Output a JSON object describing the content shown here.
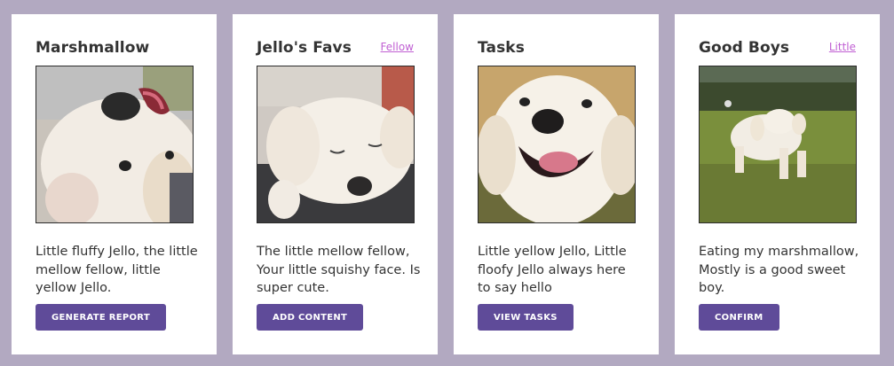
{
  "cards": [
    {
      "title": "Marshmallow",
      "link": "",
      "image_alt": "dog-photo-marshmallow",
      "text": "Little fluffy Jello, the little mellow fellow, little yellow Jello.",
      "button": "GENERATE REPORT"
    },
    {
      "title": "Jello's Favs",
      "link": "Fellow",
      "image_alt": "dog-photo-jello-lying",
      "text": "The little mellow fellow, Your little squishy face. Is super cute.",
      "button": "ADD CONTENT"
    },
    {
      "title": "Tasks",
      "link": "",
      "image_alt": "dog-photo-smiling",
      "text": "Little yellow Jello, Little floofy Jello always here to say hello",
      "button": "VIEW TASKS"
    },
    {
      "title": "Good Boys",
      "link": "Little",
      "image_alt": "dog-photo-running",
      "text": "Eating my marshmallow, Mostly is a good sweet boy.",
      "button": "CONFIRM"
    }
  ],
  "colors": {
    "page_background": "#b2a9c1",
    "card_background": "#ffffff",
    "button_background": "#5f4b99",
    "link": "#c05fd3",
    "text": "#333333"
  }
}
